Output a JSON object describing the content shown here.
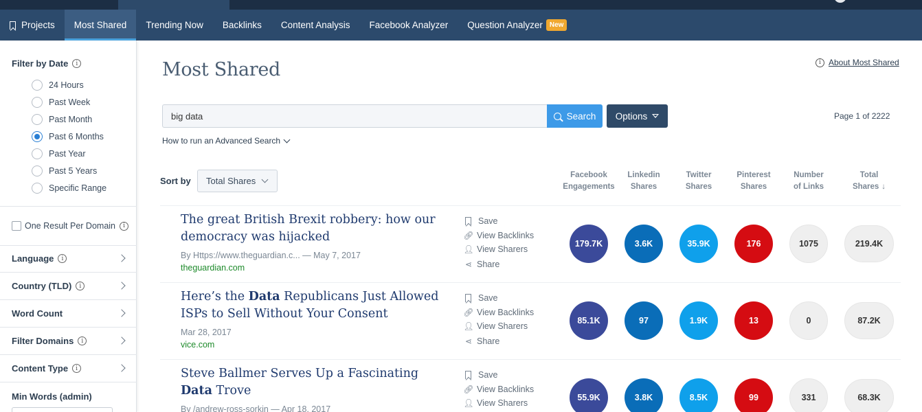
{
  "nav": {
    "items": [
      {
        "label": "Projects"
      },
      {
        "label": "Most Shared"
      },
      {
        "label": "Trending Now"
      },
      {
        "label": "Backlinks"
      },
      {
        "label": "Content Analysis"
      },
      {
        "label": "Facebook Analyzer"
      },
      {
        "label": "Question Analyzer"
      }
    ],
    "active": "Most Shared",
    "new_badge": "New"
  },
  "sidebar": {
    "filter_by_date": "Filter by Date",
    "date_options": [
      "24 Hours",
      "Past Week",
      "Past Month",
      "Past 6 Months",
      "Past Year",
      "Past 5 Years",
      "Specific Range"
    ],
    "selected_date": "Past 6 Months",
    "one_result_per_domain": "One Result Per Domain",
    "one_result_checked": false,
    "sections": [
      "Language",
      "Country (TLD)",
      "Word Count",
      "Filter Domains",
      "Content Type",
      "Min Words (admin)"
    ]
  },
  "main": {
    "title": "Most Shared",
    "about_link": "About Most Shared",
    "search_value": "big data",
    "search_button": "Search",
    "options_button": "Options",
    "page_info": "Page 1 of 2222",
    "advanced_search": "How to run an Advanced Search",
    "sort_by_label": "Sort by",
    "sort_value": "Total Shares"
  },
  "columns": [
    {
      "line1": "Facebook",
      "line2": "Engagements"
    },
    {
      "line1": "Linkedin",
      "line2": "Shares"
    },
    {
      "line1": "Twitter",
      "line2": "Shares"
    },
    {
      "line1": "Pinterest",
      "line2": "Shares"
    },
    {
      "line1": "Number",
      "line2": "of Links"
    },
    {
      "line1": "Total",
      "line2": "Shares"
    }
  ],
  "actions": {
    "save": "Save",
    "view_backlinks": "View Backlinks",
    "view_sharers": "View Sharers",
    "share": "Share"
  },
  "colors": {
    "facebook": "#3b4a9a",
    "linkedin": "#0a6db8",
    "twitter": "#0fa0eb",
    "pinterest": "#d50c12",
    "links": "#efefef"
  },
  "results": [
    {
      "title_pre": "The great British Brexit robbery: how our democracy was hijacked",
      "title_bold": "",
      "title_post": "",
      "meta": "By Https://www.theguardian.c... — May 7, 2017",
      "domain": "theguardian.com",
      "facebook": "179.7K",
      "linkedin": "3.6K",
      "twitter": "35.9K",
      "pinterest": "176",
      "links": "1075",
      "total": "219.4K"
    },
    {
      "title_pre": "Here’s the ",
      "title_bold": "Data",
      "title_post": " Republicans Just Allowed ISPs to Sell Without Your Consent",
      "meta": "Mar 28, 2017",
      "domain": "vice.com",
      "facebook": "85.1K",
      "linkedin": "97",
      "twitter": "1.9K",
      "pinterest": "13",
      "links": "0",
      "total": "87.2K"
    },
    {
      "title_pre": "Steve Ballmer Serves Up a Fascinating ",
      "title_bold": "Data",
      "title_post": " Trove",
      "meta": "By /andrew-ross-sorkin — Apr 18, 2017",
      "domain": "",
      "facebook": "55.9K",
      "linkedin": "3.8K",
      "twitter": "8.5K",
      "pinterest": "99",
      "links": "331",
      "total": "68.3K"
    }
  ]
}
